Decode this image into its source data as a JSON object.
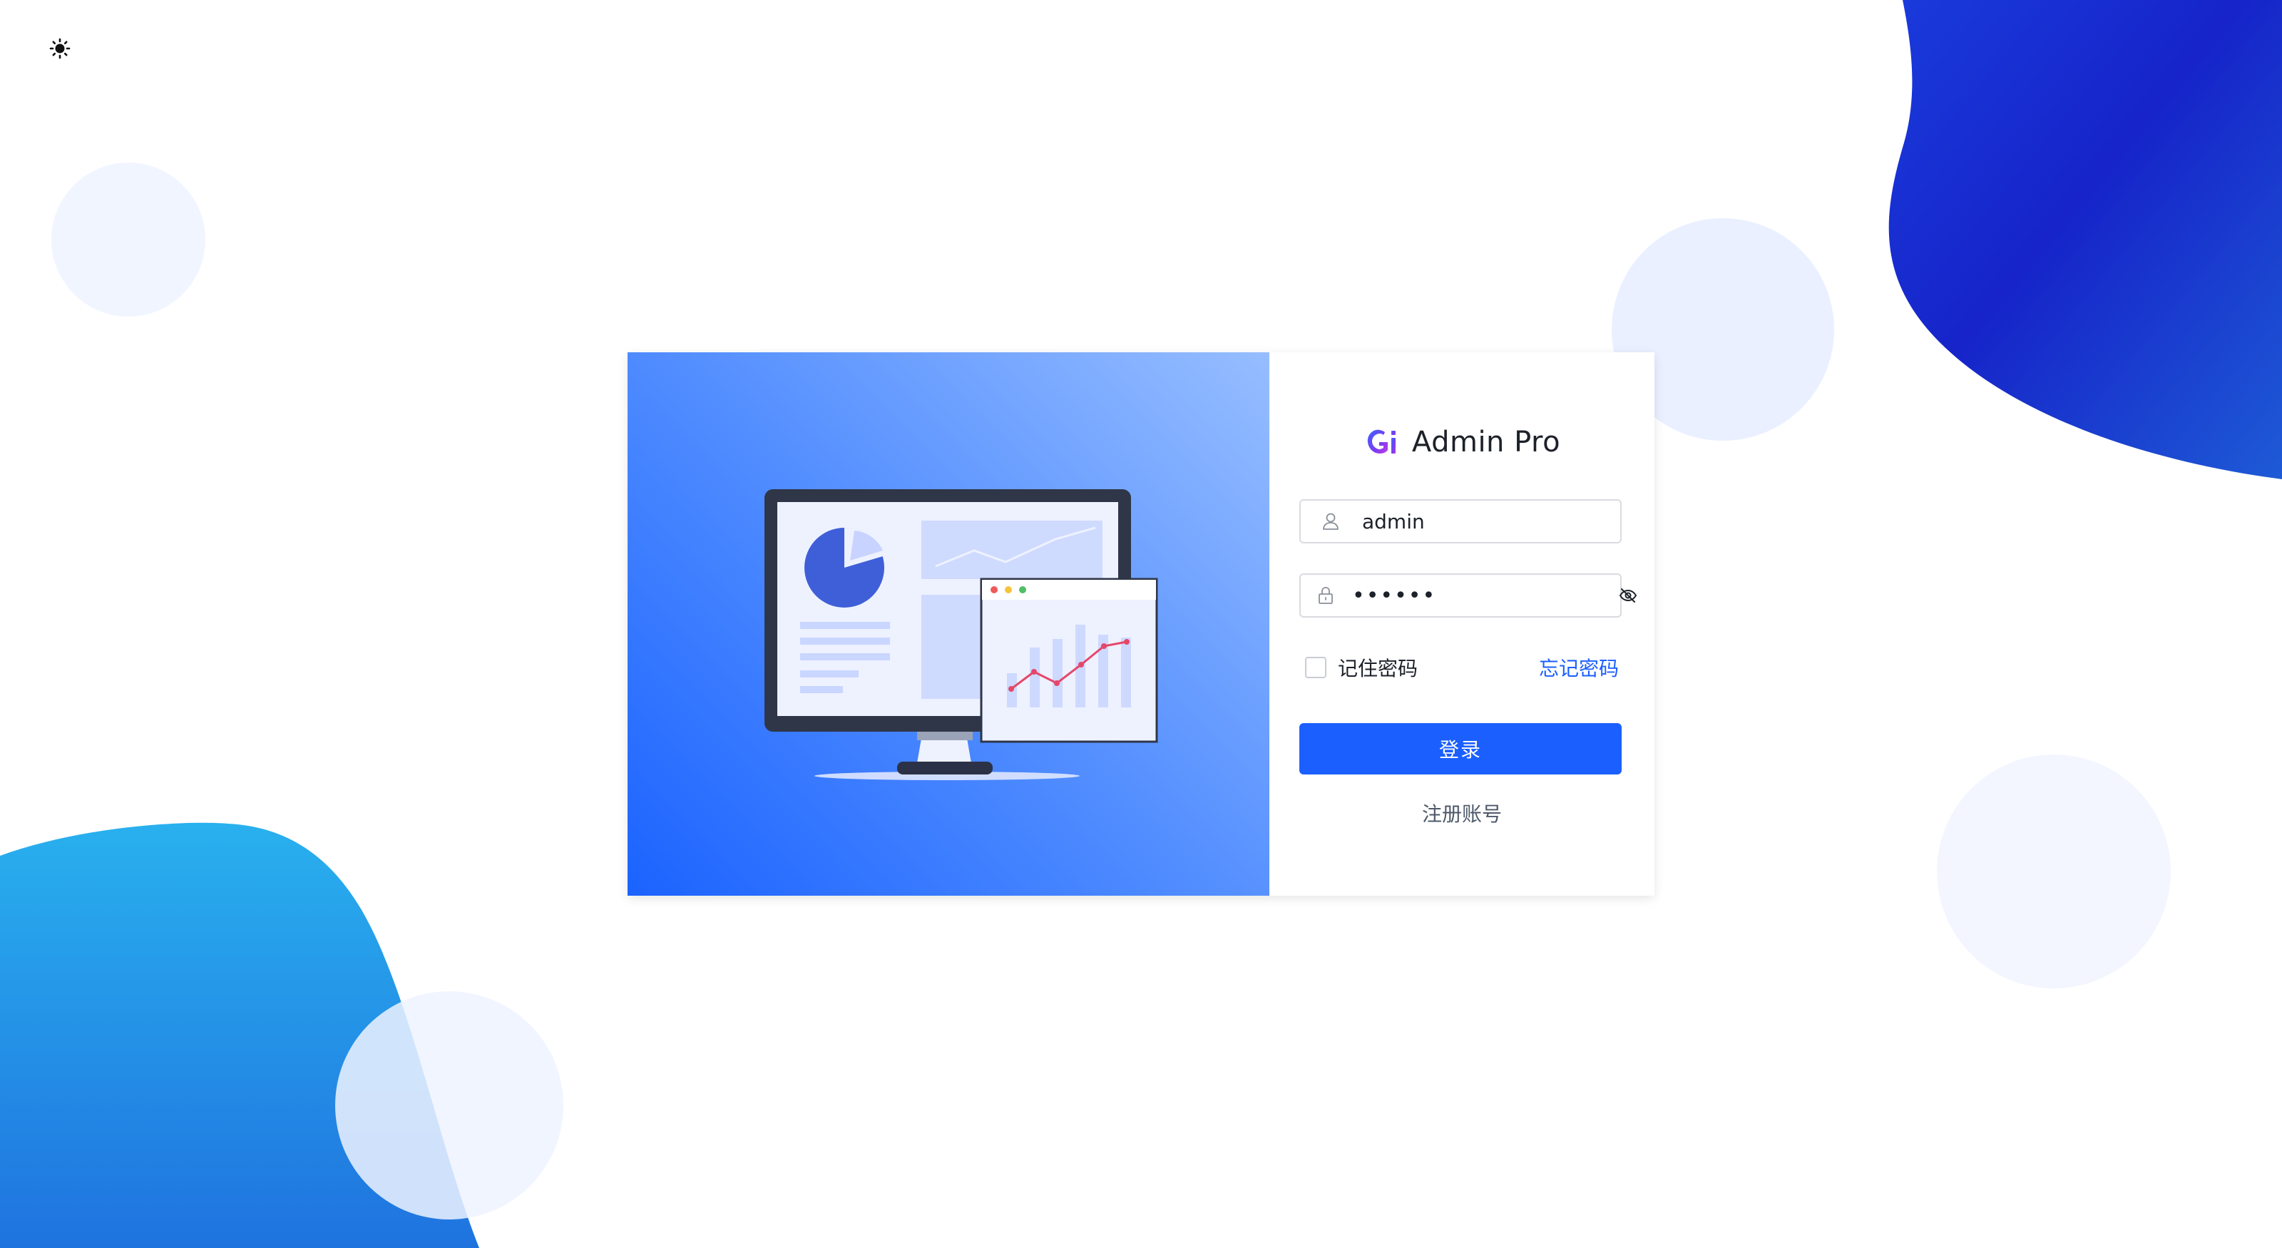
{
  "app": {
    "brand_name": "Admin Pro",
    "brand_logo_letters": "Gi"
  },
  "theme_toggle": {
    "icon": "sun-icon"
  },
  "login_form": {
    "username": {
      "value": "admin",
      "icon": "user-icon"
    },
    "password": {
      "value": "123456",
      "icon": "lock-icon",
      "visibility_icon": "eye-off-icon"
    },
    "remember_label": "记住密码",
    "remember_checked": false,
    "forgot_label": "忘记密码",
    "submit_label": "登录",
    "register_label": "注册账号"
  },
  "colors": {
    "primary": "#1b5fff",
    "text": "#1d2129",
    "muted": "#4e5969",
    "blob_top_right": "#1c3fd6",
    "blob_bottom_left": "#27a8ec",
    "bubble": "#eef3ff"
  }
}
